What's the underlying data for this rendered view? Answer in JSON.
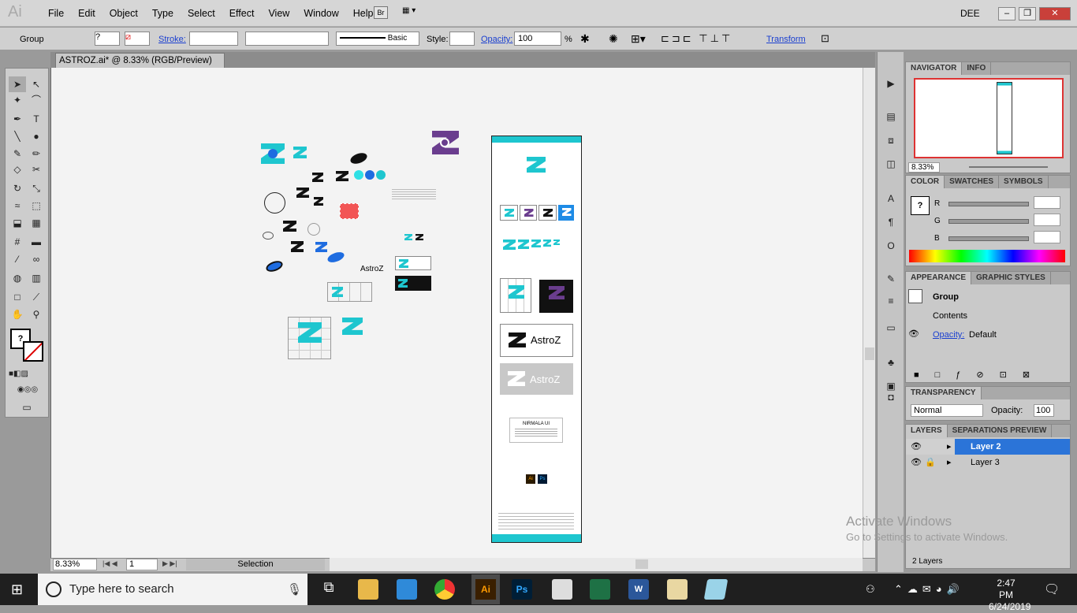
{
  "app": {
    "logo": "Ai",
    "menus": [
      "File",
      "Edit",
      "Object",
      "Type",
      "Select",
      "Effect",
      "View",
      "Window",
      "Help"
    ],
    "bridge": "Br",
    "user": "DEE"
  },
  "control": {
    "selection_type": "Group",
    "stroke_label": "Stroke:",
    "stroke_style": "Basic",
    "style_label": "Style:",
    "opacity_label": "Opacity:",
    "opacity_value": "100",
    "percent": "%",
    "transform_label": "Transform"
  },
  "document": {
    "tab_title": "ASTROZ.ai* @ 8.33% (RGB/Preview)",
    "zoom": "8.33%",
    "artboard_num": "1",
    "status": "Selection"
  },
  "canvas": {
    "astroz_word": "AstroZ",
    "astroz_big": "AstroZ",
    "nirmala": "NIRMALA UI",
    "ai_badge": "Ai",
    "ps_badge": "Ps"
  },
  "panels": {
    "navigator": {
      "tabs": [
        "NAVIGATOR",
        "INFO"
      ],
      "zoom": "8.33%"
    },
    "color": {
      "tabs": [
        "COLOR",
        "SWATCHES",
        "SYMBOLS"
      ],
      "channels": [
        "R",
        "G",
        "B"
      ]
    },
    "appearance": {
      "tabs": [
        "APPEARANCE",
        "GRAPHIC STYLES"
      ],
      "group": "Group",
      "contents": "Contents",
      "opacity_label": "Opacity:",
      "opacity_value": "Default"
    },
    "transparency": {
      "tabs": [
        "TRANSPARENCY"
      ],
      "blend": "Normal",
      "opacity_label": "Opacity:",
      "opacity_value": "100"
    },
    "layers": {
      "tabs": [
        "LAYERS",
        "SEPARATIONS PREVIEW"
      ],
      "items": [
        "Layer 2",
        "Layer 3"
      ],
      "count": "2 Layers"
    }
  },
  "watermark": {
    "line1": "Activate Windows",
    "line2": "Go to Settings to activate Windows."
  },
  "taskbar": {
    "search_placeholder": "Type here to search",
    "time": "2:47 PM",
    "date": "6/24/2019"
  },
  "colors": {
    "accent_cyan": "#1ec6cf",
    "brand_purple": "#6a3d8e",
    "brand_blue": "#1e6ce0",
    "layer_selected": "#2b74d8"
  }
}
